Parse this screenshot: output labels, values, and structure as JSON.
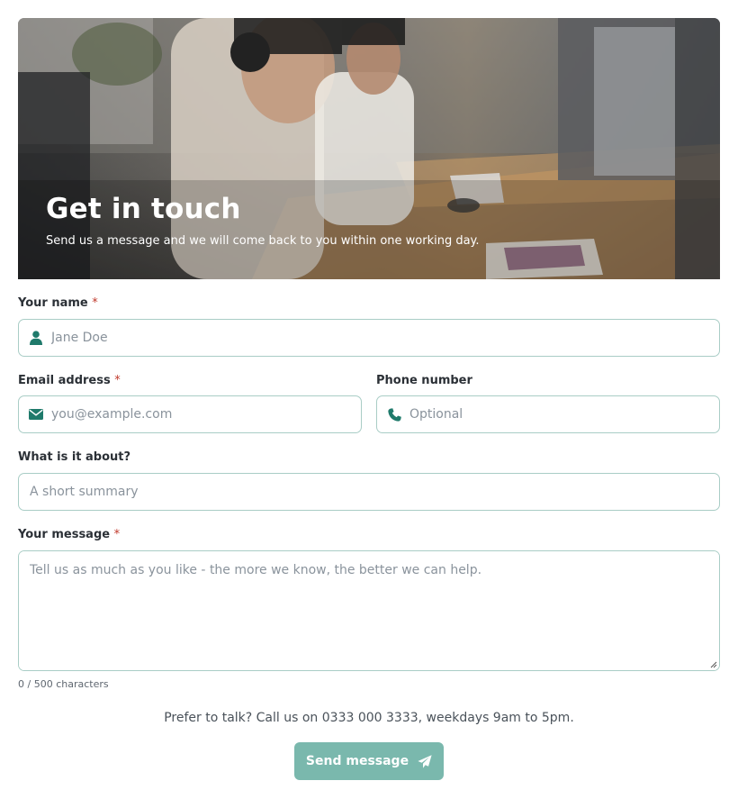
{
  "hero": {
    "title": "Get in touch",
    "subtitle": "Send us a message and we will come back to you within one working day."
  },
  "form": {
    "name": {
      "label": "Your name",
      "required_mark": "*",
      "placeholder": "Jane Doe",
      "value": "",
      "icon": "user-icon"
    },
    "email": {
      "label": "Email address",
      "required_mark": "*",
      "placeholder": "you@example.com",
      "value": "",
      "icon": "envelope-icon"
    },
    "phone": {
      "label": "Phone number",
      "placeholder": "Optional",
      "value": "",
      "icon": "phone-icon"
    },
    "subject": {
      "label": "What is it about?",
      "placeholder": "A short summary",
      "value": ""
    },
    "message": {
      "label": "Your message",
      "required_mark": "*",
      "placeholder": "Tell us as much as you like - the more we know, the better we can help.",
      "value": ""
    },
    "counter": "0 / 500 characters"
  },
  "prefer_text": "Prefer to talk? Call us on 0333 000 3333, weekdays 9am to 5pm.",
  "submit": {
    "label": "Send message",
    "icon": "paper-plane-icon"
  },
  "colors": {
    "accent": "#1f7a6b",
    "button": "#7ab8ad",
    "field_border": "#a9cdc6",
    "required": "#c0392b"
  }
}
